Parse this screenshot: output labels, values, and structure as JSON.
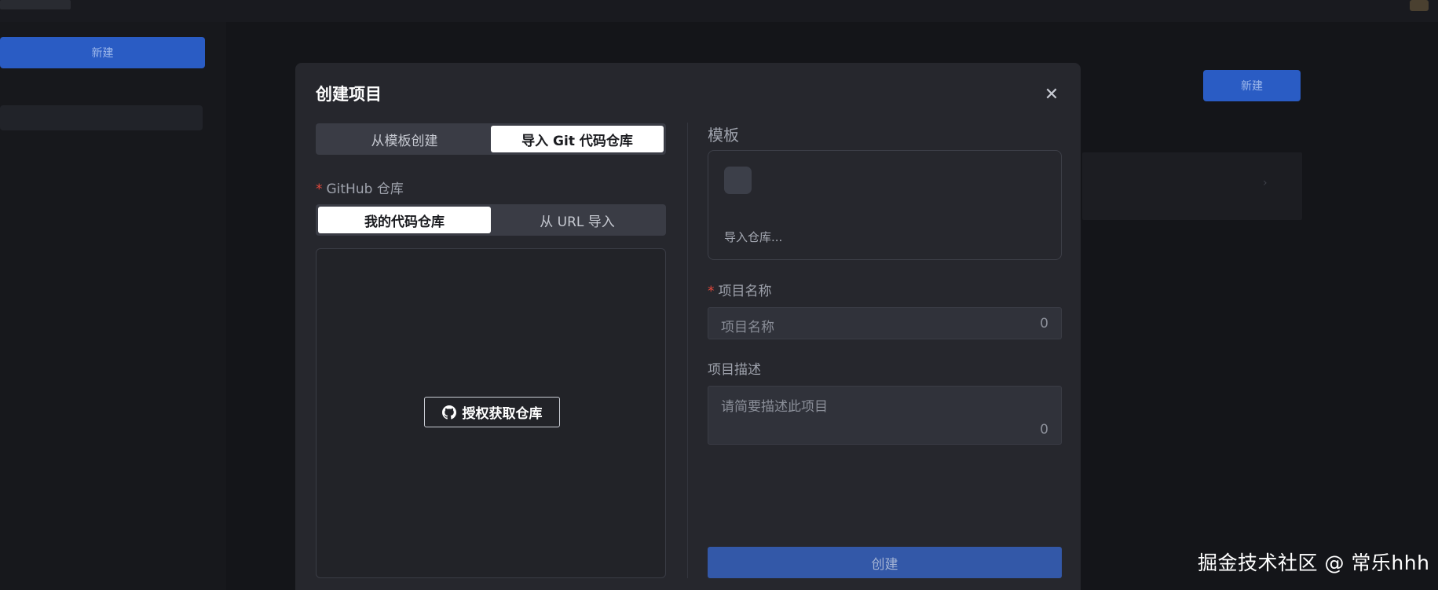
{
  "background": {
    "primary_button": "新建",
    "nav_items": [
      "",
      "",
      "",
      ""
    ],
    "new_button": "新建",
    "ghost_button": ""
  },
  "modal": {
    "title": "创建项目",
    "close_icon": "close-icon",
    "source_tabs": [
      "从模板创建",
      "导入 Git 代码仓库"
    ],
    "source_tabs_active": 1,
    "github_label": "GitHub 仓库",
    "repo_tabs": [
      "我的代码仓库",
      "从 URL 导入"
    ],
    "repo_tabs_active": 0,
    "auth_button": "授权获取仓库",
    "template_label": "模板",
    "template_text": "导入仓库...",
    "name_label": "项目名称",
    "name_placeholder": "项目名称",
    "name_count": "0",
    "desc_label": "项目描述",
    "desc_placeholder": "请简要描述此项目",
    "desc_count": "0",
    "create_button": "创建"
  },
  "watermark": "掘金技术社区 @ 常乐hhh",
  "colors": {
    "accent": "#3358a8",
    "required": "#e5483b",
    "modal_bg": "#26272d"
  }
}
